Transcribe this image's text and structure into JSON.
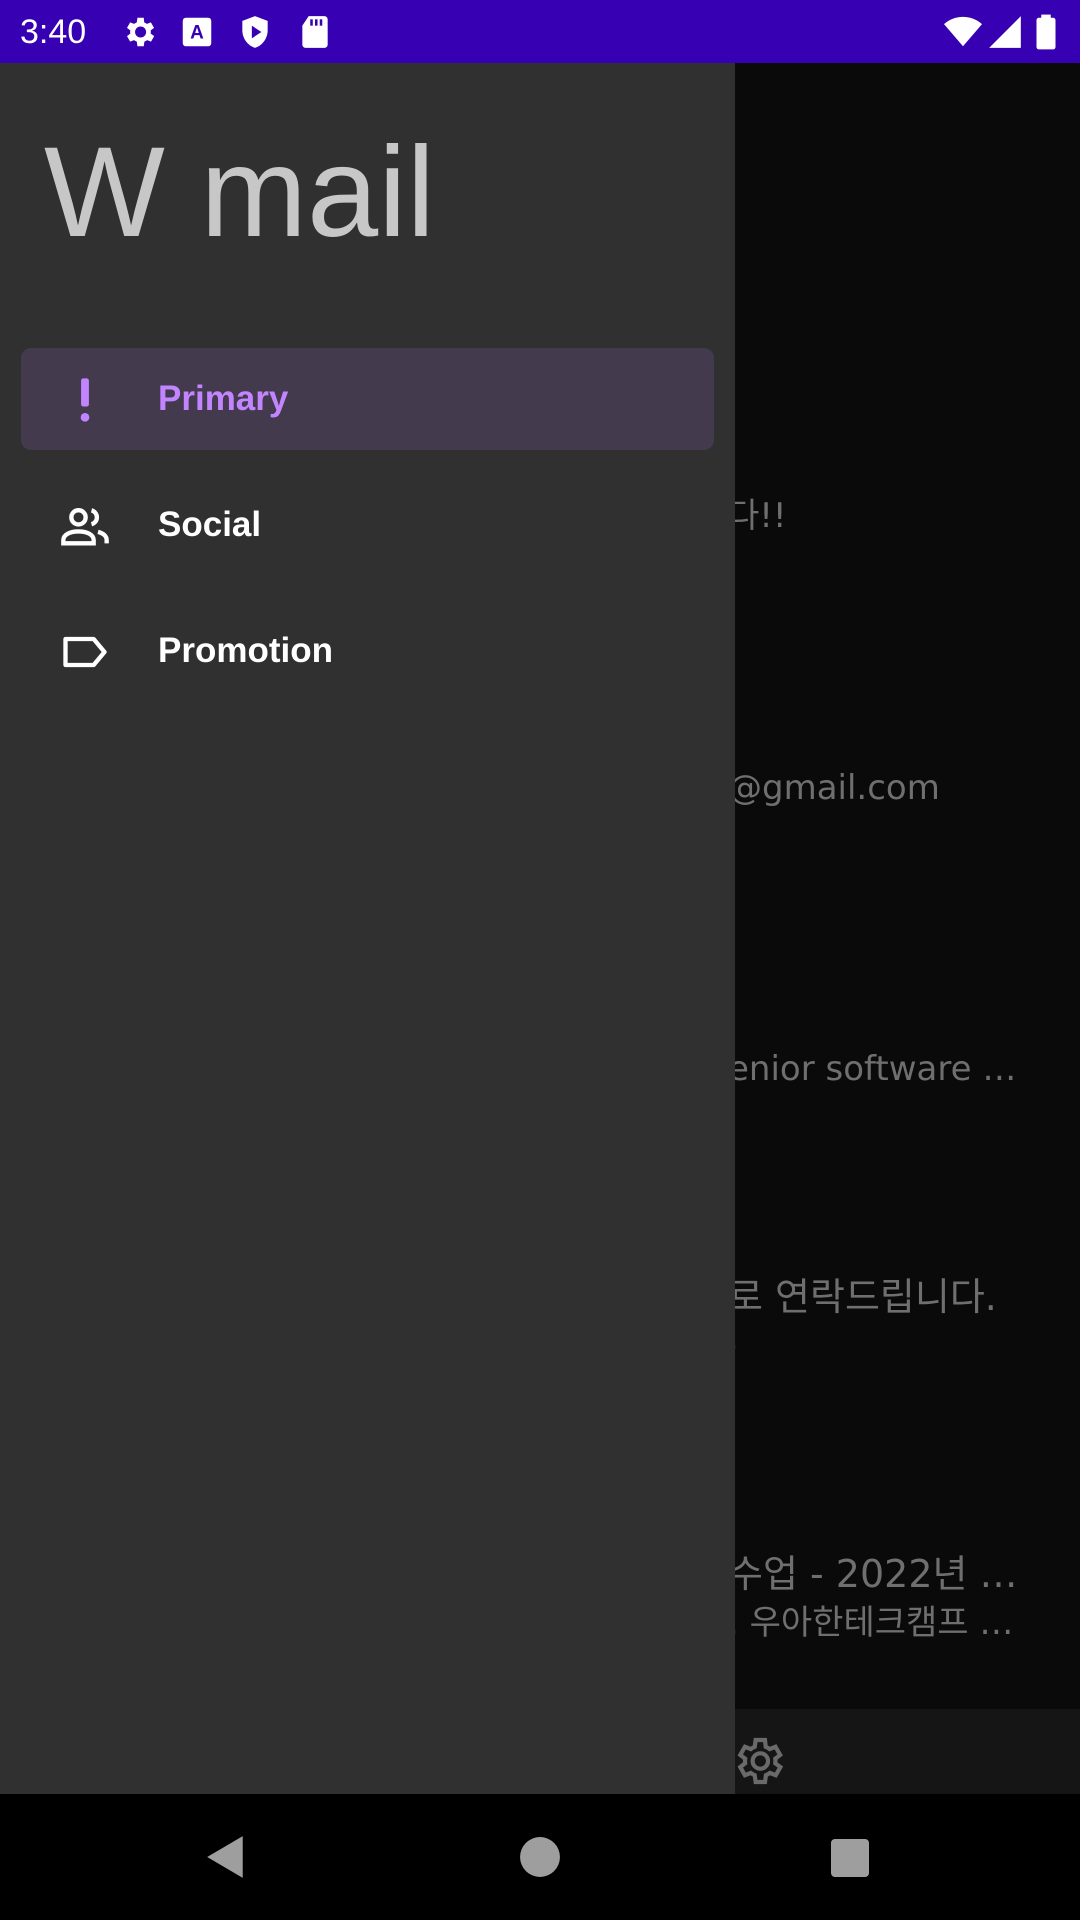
{
  "status_bar": {
    "time": "3:40",
    "background": "#3700B3",
    "icons": [
      "settings-icon",
      "font-a-icon",
      "shield-play-icon",
      "sd-card-icon",
      "wifi-icon",
      "signal-icon",
      "battery-icon"
    ]
  },
  "drawer": {
    "title": "W mail",
    "items": [
      {
        "label": "Primary",
        "icon": "exclamation-icon",
        "selected": true
      },
      {
        "label": "Social",
        "icon": "people-icon",
        "selected": false
      },
      {
        "label": "Promotion",
        "icon": "label-tag-icon",
        "selected": false
      }
    ],
    "accent": "#c285ff"
  },
  "background_list": {
    "fragments": [
      "다!!",
      "@gmail.com",
      "enior software …",
      "로 연락드립니다.",
      ".",
      "수업 - 2022년 …",
      ". 우아한테크캠프 …"
    ],
    "bottom_nav_label": "etting"
  }
}
